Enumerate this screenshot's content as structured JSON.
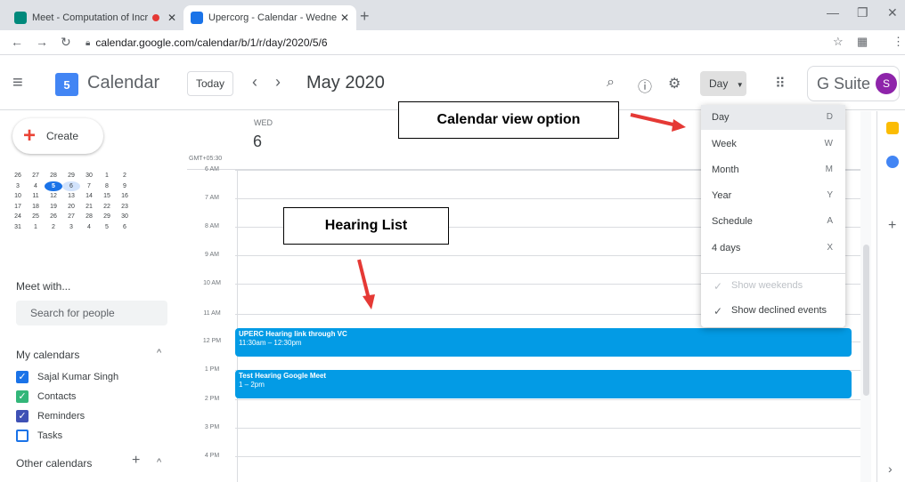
{
  "browser": {
    "tabs": [
      {
        "title": "Meet - Computation of Incre",
        "favicon_color": "#00897b"
      },
      {
        "title": "Upercorg - Calendar - Wednesda",
        "favicon_color": "#1a73e8"
      }
    ],
    "url": "calendar.google.com/calendar/b/1/r/day/2020/5/6"
  },
  "header": {
    "logo_day": "5",
    "app_name": "Calendar",
    "today_label": "Today",
    "prev_icon": "‹",
    "next_icon": "›",
    "date_title": "May 2020",
    "view_label": "Day",
    "suite_label": "G Suite",
    "avatar_initial": "S"
  },
  "sidebar": {
    "create_label": "Create",
    "mini_calendar": [
      [
        "26",
        "27",
        "28",
        "29",
        "30",
        "1",
        "2"
      ],
      [
        "3",
        "4",
        "5",
        "6",
        "7",
        "8",
        "9"
      ],
      [
        "10",
        "11",
        "12",
        "13",
        "14",
        "15",
        "16"
      ],
      [
        "17",
        "18",
        "19",
        "20",
        "21",
        "22",
        "23"
      ],
      [
        "24",
        "25",
        "26",
        "27",
        "28",
        "29",
        "30"
      ],
      [
        "31",
        "1",
        "2",
        "3",
        "4",
        "5",
        "6"
      ]
    ],
    "meet_title": "Meet with...",
    "search_placeholder": "Search for people",
    "my_calendars_title": "My calendars",
    "my_calendars": [
      {
        "name": "Sajal Kumar Singh",
        "color": "#1a73e8",
        "checked": true
      },
      {
        "name": "Contacts",
        "color": "#33b679",
        "checked": true
      },
      {
        "name": "Reminders",
        "color": "#3f51b5",
        "checked": true
      },
      {
        "name": "Tasks",
        "color": "#1a73e8",
        "checked": false
      }
    ],
    "other_calendars_title": "Other calendars"
  },
  "day_view": {
    "weekday": "WED",
    "day_number": "6",
    "timezone": "GMT+05:30",
    "hours": [
      "6 AM",
      "7 AM",
      "8 AM",
      "9 AM",
      "10 AM",
      "11 AM",
      "12 PM",
      "1 PM",
      "2 PM",
      "3 PM",
      "4 PM"
    ],
    "events": [
      {
        "title": "UPERC Hearing link through VC",
        "time": "11:30am – 12:30pm",
        "color": "#039be5"
      },
      {
        "title": "Test Hearing Google Meet",
        "time": "1 – 2pm",
        "color": "#039be5"
      }
    ]
  },
  "view_menu": {
    "items": [
      {
        "label": "Day",
        "key": "D"
      },
      {
        "label": "Week",
        "key": "W"
      },
      {
        "label": "Month",
        "key": "M"
      },
      {
        "label": "Year",
        "key": "Y"
      },
      {
        "label": "Schedule",
        "key": "A"
      },
      {
        "label": "4 days",
        "key": "X"
      }
    ],
    "show_weekends": "Show weekends",
    "show_declined": "Show declined events"
  },
  "annotations": {
    "view_option": "Calendar view option",
    "hearing_list": "Hearing List",
    "arrow_color": "#e53935"
  }
}
